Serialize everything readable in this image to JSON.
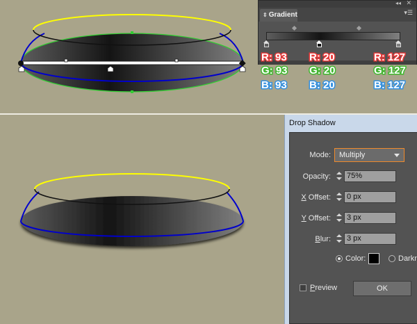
{
  "colors": {
    "background": "#a9a48a",
    "yellow_path": "#ffff00",
    "blue_path": "#0000cc",
    "green_path": "#33cc33",
    "red_label": "#e83a3a",
    "green_label": "#3fb82e",
    "blue_label": "#3390e0",
    "dialog_accent": "#f08a2b"
  },
  "gradient_panel": {
    "tab_label": "Gradient",
    "collapse_icon": "double-chevron-icon",
    "close_icon": "close-icon",
    "menu_icon": "panel-menu-icon",
    "stops": [
      {
        "r": "R: 93",
        "g": "G: 93",
        "b": "B: 93",
        "position": 0
      },
      {
        "r": "R: 20",
        "g": "G: 20",
        "b": "B: 20",
        "position": 40
      },
      {
        "r": "R: 127",
        "g": "G: 127",
        "b": "B: 127",
        "position": 100
      }
    ]
  },
  "drop_shadow": {
    "title": "Drop Shadow",
    "mode_label": "Mode:",
    "mode_value": "Multiply",
    "opacity_label": "Opacity:",
    "opacity_value": "75%",
    "x_offset_label": "Offset:",
    "x_offset_mnemonic": "X",
    "x_offset_value": "0 px",
    "y_offset_label": "Offset:",
    "y_offset_mnemonic": "Y",
    "y_offset_value": "3 px",
    "blur_label": "lur:",
    "blur_mnemonic": "B",
    "blur_value": "3 px",
    "color_label": "Color:",
    "darkness_label": "Darkn",
    "preview_label": "review",
    "preview_mnemonic": "P",
    "ok_label": "OK"
  }
}
